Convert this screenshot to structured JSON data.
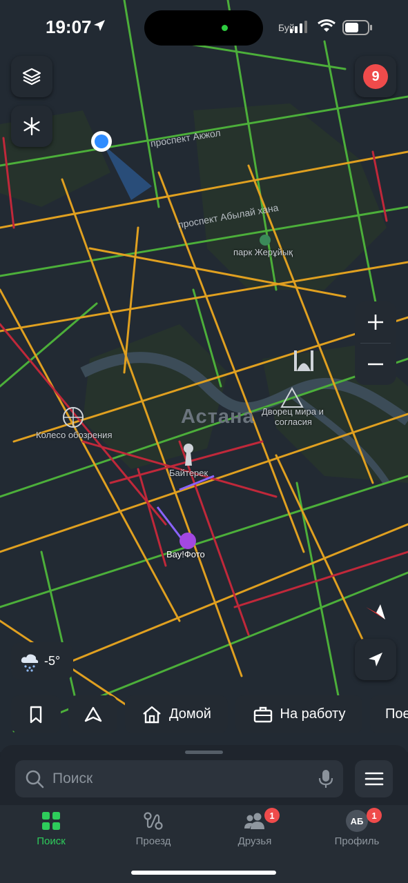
{
  "status": {
    "time": "19:07",
    "carrier": "Буй"
  },
  "map": {
    "camera_badge": "9",
    "streets": [
      "проспект Акжол",
      "проспект Абылай хана"
    ],
    "city": "Астана",
    "places": {
      "park": "парк Жерұйық",
      "ferris": "Колесо обозрения",
      "palace_1": "Дворец мира и",
      "palace_2": "согласия",
      "baiterek": "Байтерек",
      "vau": "Вау!Фото"
    },
    "zoom_in": "+",
    "zoom_out": "−",
    "weather": {
      "temp": "-5°",
      "icon": "snow-cloud-icon"
    }
  },
  "chips": {
    "home": "Домой",
    "work": "На работу",
    "partial": "Пое"
  },
  "search": {
    "placeholder": "Поиск"
  },
  "tabs": [
    {
      "label": "Поиск"
    },
    {
      "label": "Проезд"
    },
    {
      "label": "Друзья",
      "badge": "1"
    },
    {
      "label": "Профиль",
      "badge": "1",
      "avatar": "АБ"
    }
  ],
  "colors": {
    "accent": "#2ecc5b",
    "badge": "#ef4b4b",
    "traffic_free": "#4caf3a",
    "traffic_slow": "#e0a020",
    "traffic_jam": "#c0283a"
  }
}
